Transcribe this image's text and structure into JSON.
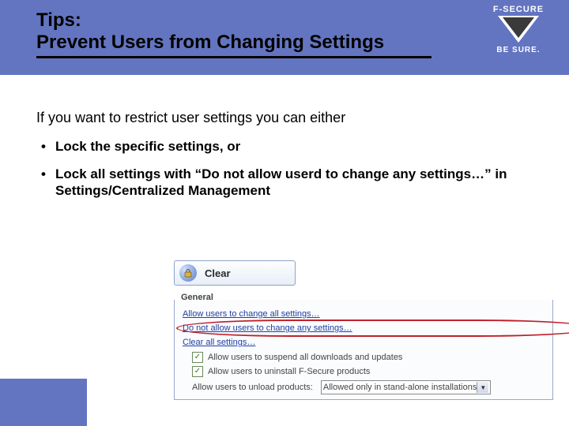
{
  "header": {
    "title_line1": "Tips:",
    "title_line2": "Prevent Users from Changing Settings"
  },
  "brand": {
    "name": "F-SECURE",
    "tagline": "BE SURE."
  },
  "body": {
    "lead": "If you want to restrict user settings you can either",
    "bullets": [
      "Lock the specific settings, or",
      "Lock all settings with “Do not allow userd to change any settings…” in Settings/Centralized Management"
    ]
  },
  "uimock": {
    "clear_label": "Clear",
    "panel_title": "General",
    "links": {
      "allow_all": "Allow users to change all settings…",
      "deny_all": "Do not allow users to change any settings…",
      "clear_all": "Clear all settings…"
    },
    "checks": {
      "suspend": "Allow users to suspend all downloads and updates",
      "uninstall": "Allow users to uninstall F-Secure products"
    },
    "unload_row": {
      "label": "Allow users to unload products:",
      "value": "Allowed only in stand-alone installations"
    }
  }
}
